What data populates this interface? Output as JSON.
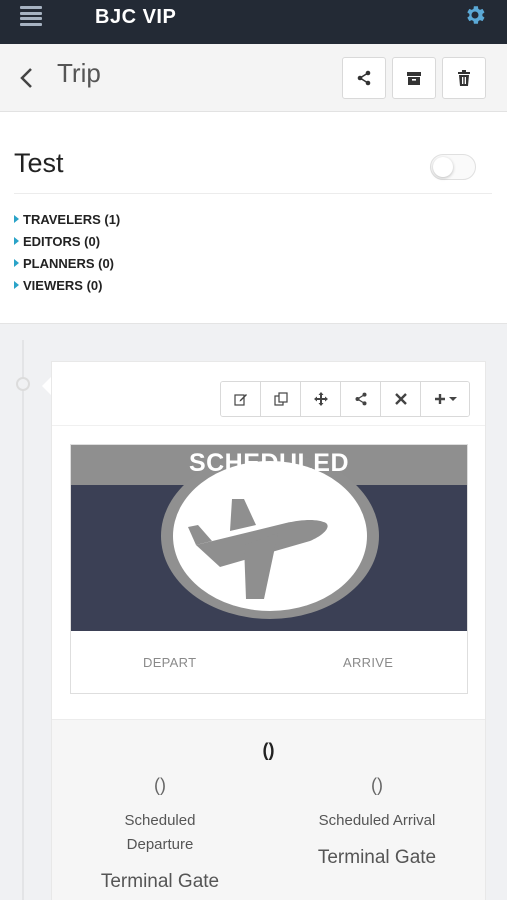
{
  "app": {
    "title": "BJC VIP"
  },
  "header": {
    "title": "Trip"
  },
  "trip": {
    "name": "Test",
    "roles": [
      {
        "label": "TRAVELERS (1)"
      },
      {
        "label": "EDITORS (0)"
      },
      {
        "label": "PLANNERS (0)"
      },
      {
        "label": "VIEWERS (0)"
      }
    ]
  },
  "segment": {
    "status": "SCHEDULED",
    "depart_label": "DEPART",
    "arrive_label": "ARRIVE",
    "flight_id": "()",
    "departure": {
      "time": "()",
      "label": "Scheduled Departure",
      "gate_label": "Terminal Gate"
    },
    "arrival": {
      "time": "()",
      "label": "Scheduled Arrival",
      "gate_label": "Terminal Gate"
    }
  },
  "colors": {
    "topbar": "#232a35",
    "accent": "#2aa3c8",
    "banner": "#3b4055",
    "banner_top": "#8f8f8f"
  }
}
